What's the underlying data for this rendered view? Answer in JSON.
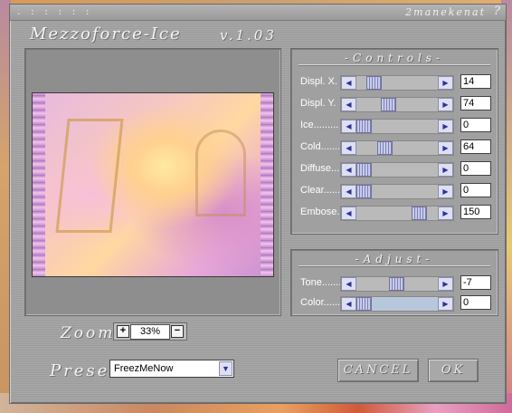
{
  "titlebar": {
    "dots": ". : : : : :",
    "credit": "2manekenat",
    "help": "?"
  },
  "app": {
    "title": "Mezzoforce-Ice",
    "version": "v.1.03"
  },
  "controls": {
    "title": "-Controls-",
    "sliders": [
      {
        "label": "Displ. X.",
        "value": "14"
      },
      {
        "label": "Displ. Y.",
        "value": "74"
      },
      {
        "label": "Ice.........",
        "value": "0"
      },
      {
        "label": "Cold.......",
        "value": "64"
      },
      {
        "label": "Diffuse....",
        "value": "0"
      },
      {
        "label": "Clear......",
        "value": "0"
      },
      {
        "label": "Embose.",
        "value": "150"
      }
    ]
  },
  "adjust": {
    "title": "-Adjust-",
    "sliders": [
      {
        "label": "Tone.......",
        "value": "-7"
      },
      {
        "label": "Color.......",
        "value": "0"
      }
    ]
  },
  "zoom": {
    "label": "Zoom",
    "value": "33%",
    "plus": "+",
    "minus": "−"
  },
  "preset": {
    "label": "Preset",
    "selected": "FreezMeNow"
  },
  "buttons": {
    "cancel": "CANCEL",
    "ok": "OK"
  },
  "icons": {
    "arrow_left": "◀",
    "arrow_right": "▶",
    "dropdown": "▼"
  }
}
